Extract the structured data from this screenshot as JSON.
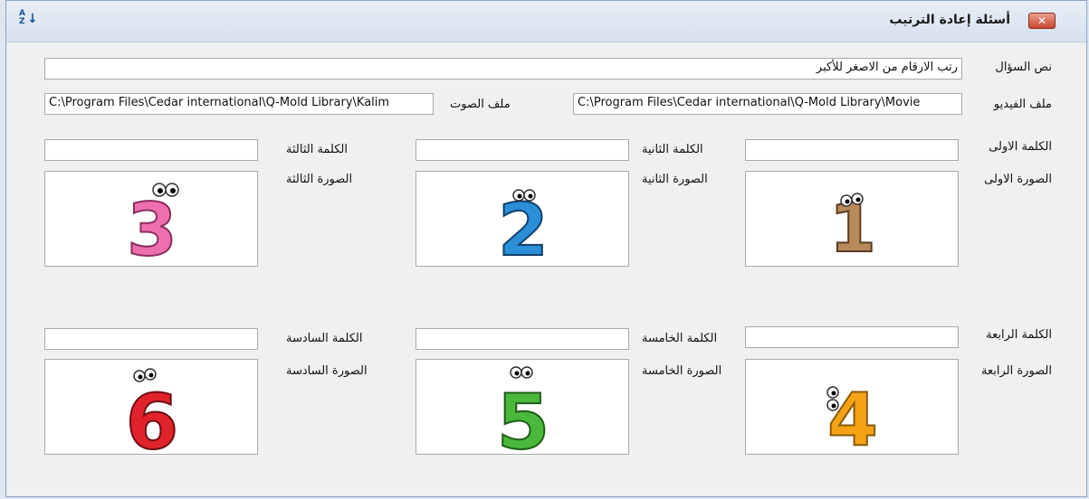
{
  "window": {
    "title": "أسئلة إعادة الترتيب",
    "close_icon": "close-x-icon",
    "sort_icon": "sort-az-icon"
  },
  "question": {
    "label": "نص السؤال",
    "value": "رتب الارقام من الاصغر للأكبر"
  },
  "video": {
    "label": "ملف الفيديو",
    "value": "C:\\Program Files\\Cedar international\\Q-Mold Library\\Movie"
  },
  "audio": {
    "label": "ملف الصوت",
    "value": "C:\\Program Files\\Cedar international\\Q-Mold Library\\Kalim"
  },
  "items": [
    {
      "word_label": "الكلمة الاولى",
      "word_value": "",
      "image_label": "الصورة الاولى",
      "image": "number-1-cartoon",
      "color": "#b8895a"
    },
    {
      "word_label": "الكلمة الثانية",
      "word_value": "",
      "image_label": "الصورة الثانية",
      "image": "number-2-cartoon",
      "color": "#2a8fd6"
    },
    {
      "word_label": "الكلمة الثالثة",
      "word_value": "",
      "image_label": "الصورة الثالثة",
      "image": "number-3-cartoon",
      "color": "#ee6fb0"
    },
    {
      "word_label": "الكلمة الرابعة",
      "word_value": "",
      "image_label": "الصورة الرابعة",
      "image": "number-4-cartoon",
      "color": "#f5a316"
    },
    {
      "word_label": "الكلمة الخامسة",
      "word_value": "",
      "image_label": "الصورة الخامسة",
      "image": "number-5-cartoon",
      "color": "#49b83c"
    },
    {
      "word_label": "الكلمة السادسة",
      "word_value": "",
      "image_label": "الصورة السادسة",
      "image": "number-6-cartoon",
      "color": "#e0222b"
    }
  ],
  "glyphs": {
    "n1": "1",
    "n2": "2",
    "n3": "3",
    "n4": "4",
    "n5": "5",
    "n6": "6"
  }
}
